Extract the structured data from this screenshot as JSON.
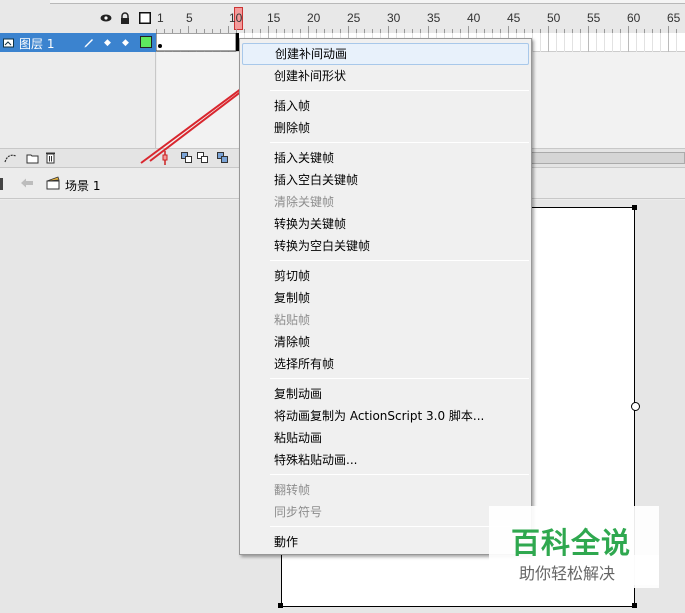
{
  "timeline": {
    "ruler": [
      "1",
      "5",
      "10",
      "15",
      "20",
      "25",
      "30",
      "35",
      "40",
      "45",
      "50",
      "55",
      "60",
      "65"
    ],
    "layer": {
      "name": "图层 1"
    },
    "scene": {
      "label": "场景 1"
    }
  },
  "context_menu": {
    "groups": [
      [
        {
          "label": "创建补间动画",
          "enabled": true,
          "highlighted": true
        },
        {
          "label": "创建补间形状",
          "enabled": true
        }
      ],
      [
        {
          "label": "插入帧",
          "enabled": true
        },
        {
          "label": "删除帧",
          "enabled": true
        }
      ],
      [
        {
          "label": "插入关键帧",
          "enabled": true
        },
        {
          "label": "插入空白关键帧",
          "enabled": true
        },
        {
          "label": "清除关键帧",
          "enabled": false
        },
        {
          "label": "转换为关键帧",
          "enabled": true
        },
        {
          "label": "转换为空白关键帧",
          "enabled": true
        }
      ],
      [
        {
          "label": "剪切帧",
          "enabled": true
        },
        {
          "label": "复制帧",
          "enabled": true
        },
        {
          "label": "粘贴帧",
          "enabled": false
        },
        {
          "label": "清除帧",
          "enabled": true
        },
        {
          "label": "选择所有帧",
          "enabled": true
        }
      ],
      [
        {
          "label": "复制动画",
          "enabled": true
        },
        {
          "label": "将动画复制为 ActionScript 3.0 脚本...",
          "enabled": true
        },
        {
          "label": "粘贴动画",
          "enabled": true
        },
        {
          "label": "特殊粘贴动画...",
          "enabled": true
        }
      ],
      [
        {
          "label": "翻转帧",
          "enabled": false
        },
        {
          "label": "同步符号",
          "enabled": false
        }
      ],
      [
        {
          "label": "動作",
          "enabled": true
        }
      ]
    ]
  },
  "watermark": {
    "title": "百科全说",
    "subtitle": "助你轻松解决"
  },
  "colors": {
    "layer_selected": "#3b83cf",
    "playhead": "#f39a9a",
    "arrow": "#d9262e",
    "watermark_green": "#2fa84f"
  }
}
